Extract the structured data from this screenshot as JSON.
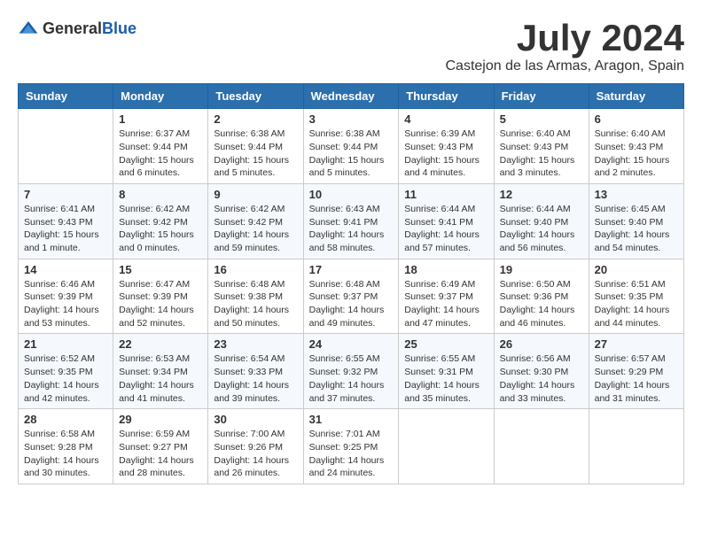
{
  "logo": {
    "text_general": "General",
    "text_blue": "Blue"
  },
  "title": {
    "month": "July 2024",
    "location": "Castejon de las Armas, Aragon, Spain"
  },
  "headers": [
    "Sunday",
    "Monday",
    "Tuesday",
    "Wednesday",
    "Thursday",
    "Friday",
    "Saturday"
  ],
  "weeks": [
    [
      {
        "day": "",
        "info": ""
      },
      {
        "day": "1",
        "info": "Sunrise: 6:37 AM\nSunset: 9:44 PM\nDaylight: 15 hours\nand 6 minutes."
      },
      {
        "day": "2",
        "info": "Sunrise: 6:38 AM\nSunset: 9:44 PM\nDaylight: 15 hours\nand 5 minutes."
      },
      {
        "day": "3",
        "info": "Sunrise: 6:38 AM\nSunset: 9:44 PM\nDaylight: 15 hours\nand 5 minutes."
      },
      {
        "day": "4",
        "info": "Sunrise: 6:39 AM\nSunset: 9:43 PM\nDaylight: 15 hours\nand 4 minutes."
      },
      {
        "day": "5",
        "info": "Sunrise: 6:40 AM\nSunset: 9:43 PM\nDaylight: 15 hours\nand 3 minutes."
      },
      {
        "day": "6",
        "info": "Sunrise: 6:40 AM\nSunset: 9:43 PM\nDaylight: 15 hours\nand 2 minutes."
      }
    ],
    [
      {
        "day": "7",
        "info": "Sunrise: 6:41 AM\nSunset: 9:43 PM\nDaylight: 15 hours\nand 1 minute."
      },
      {
        "day": "8",
        "info": "Sunrise: 6:42 AM\nSunset: 9:42 PM\nDaylight: 15 hours\nand 0 minutes."
      },
      {
        "day": "9",
        "info": "Sunrise: 6:42 AM\nSunset: 9:42 PM\nDaylight: 14 hours\nand 59 minutes."
      },
      {
        "day": "10",
        "info": "Sunrise: 6:43 AM\nSunset: 9:41 PM\nDaylight: 14 hours\nand 58 minutes."
      },
      {
        "day": "11",
        "info": "Sunrise: 6:44 AM\nSunset: 9:41 PM\nDaylight: 14 hours\nand 57 minutes."
      },
      {
        "day": "12",
        "info": "Sunrise: 6:44 AM\nSunset: 9:40 PM\nDaylight: 14 hours\nand 56 minutes."
      },
      {
        "day": "13",
        "info": "Sunrise: 6:45 AM\nSunset: 9:40 PM\nDaylight: 14 hours\nand 54 minutes."
      }
    ],
    [
      {
        "day": "14",
        "info": "Sunrise: 6:46 AM\nSunset: 9:39 PM\nDaylight: 14 hours\nand 53 minutes."
      },
      {
        "day": "15",
        "info": "Sunrise: 6:47 AM\nSunset: 9:39 PM\nDaylight: 14 hours\nand 52 minutes."
      },
      {
        "day": "16",
        "info": "Sunrise: 6:48 AM\nSunset: 9:38 PM\nDaylight: 14 hours\nand 50 minutes."
      },
      {
        "day": "17",
        "info": "Sunrise: 6:48 AM\nSunset: 9:37 PM\nDaylight: 14 hours\nand 49 minutes."
      },
      {
        "day": "18",
        "info": "Sunrise: 6:49 AM\nSunset: 9:37 PM\nDaylight: 14 hours\nand 47 minutes."
      },
      {
        "day": "19",
        "info": "Sunrise: 6:50 AM\nSunset: 9:36 PM\nDaylight: 14 hours\nand 46 minutes."
      },
      {
        "day": "20",
        "info": "Sunrise: 6:51 AM\nSunset: 9:35 PM\nDaylight: 14 hours\nand 44 minutes."
      }
    ],
    [
      {
        "day": "21",
        "info": "Sunrise: 6:52 AM\nSunset: 9:35 PM\nDaylight: 14 hours\nand 42 minutes."
      },
      {
        "day": "22",
        "info": "Sunrise: 6:53 AM\nSunset: 9:34 PM\nDaylight: 14 hours\nand 41 minutes."
      },
      {
        "day": "23",
        "info": "Sunrise: 6:54 AM\nSunset: 9:33 PM\nDaylight: 14 hours\nand 39 minutes."
      },
      {
        "day": "24",
        "info": "Sunrise: 6:55 AM\nSunset: 9:32 PM\nDaylight: 14 hours\nand 37 minutes."
      },
      {
        "day": "25",
        "info": "Sunrise: 6:55 AM\nSunset: 9:31 PM\nDaylight: 14 hours\nand 35 minutes."
      },
      {
        "day": "26",
        "info": "Sunrise: 6:56 AM\nSunset: 9:30 PM\nDaylight: 14 hours\nand 33 minutes."
      },
      {
        "day": "27",
        "info": "Sunrise: 6:57 AM\nSunset: 9:29 PM\nDaylight: 14 hours\nand 31 minutes."
      }
    ],
    [
      {
        "day": "28",
        "info": "Sunrise: 6:58 AM\nSunset: 9:28 PM\nDaylight: 14 hours\nand 30 minutes."
      },
      {
        "day": "29",
        "info": "Sunrise: 6:59 AM\nSunset: 9:27 PM\nDaylight: 14 hours\nand 28 minutes."
      },
      {
        "day": "30",
        "info": "Sunrise: 7:00 AM\nSunset: 9:26 PM\nDaylight: 14 hours\nand 26 minutes."
      },
      {
        "day": "31",
        "info": "Sunrise: 7:01 AM\nSunset: 9:25 PM\nDaylight: 14 hours\nand 24 minutes."
      },
      {
        "day": "",
        "info": ""
      },
      {
        "day": "",
        "info": ""
      },
      {
        "day": "",
        "info": ""
      }
    ]
  ]
}
